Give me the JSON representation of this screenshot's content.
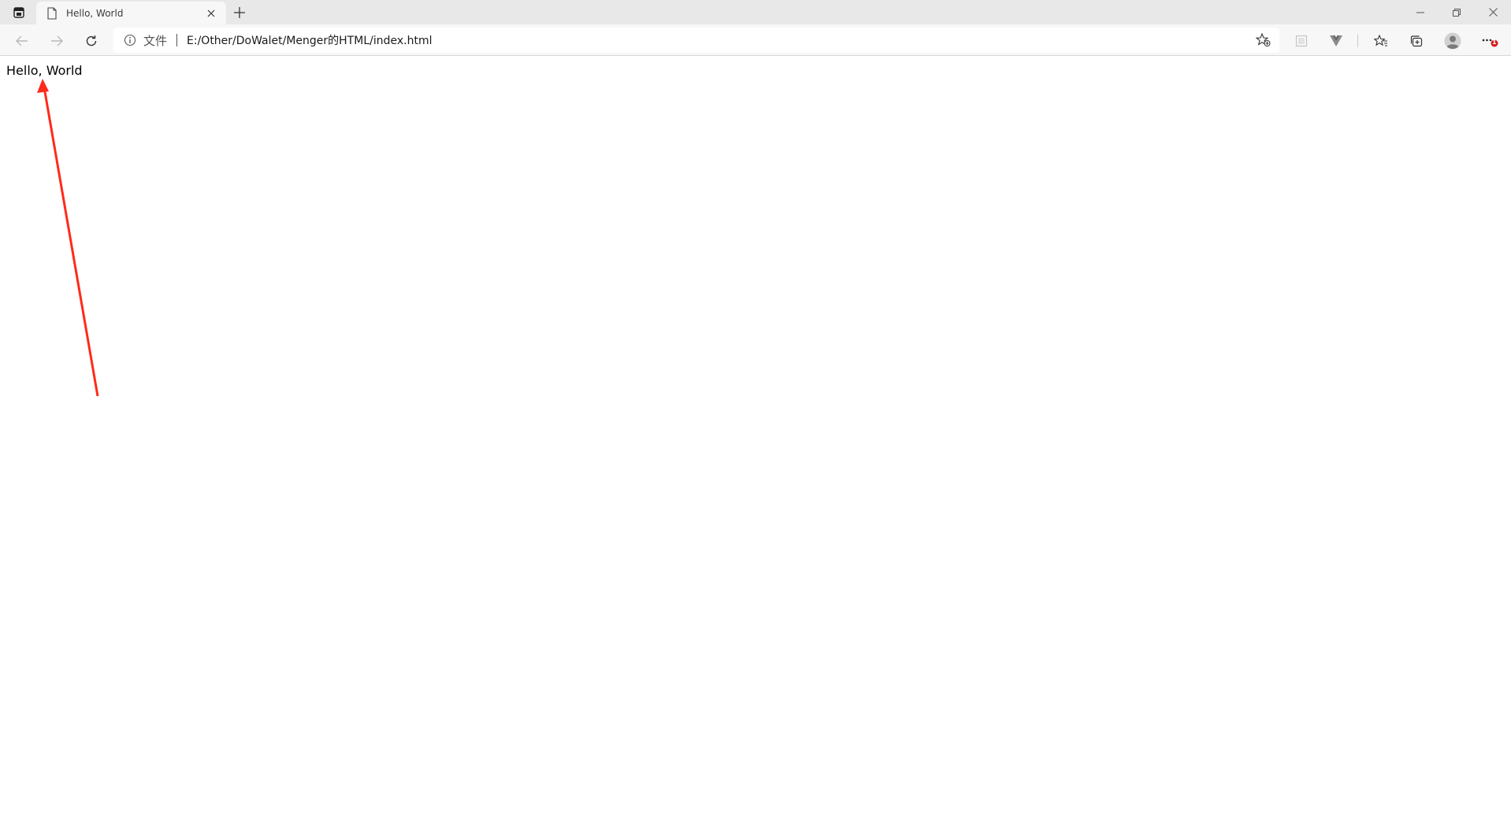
{
  "tab": {
    "title": "Hello, World"
  },
  "omnibox": {
    "scheme_label": "文件",
    "url": "E:/Other/DoWalet/Menger的HTML/index.html"
  },
  "page": {
    "text": "Hello, World"
  },
  "notification_badge": "1",
  "colors": {
    "annotation_arrow": "#ff2a1a",
    "badge": "#d81b1b"
  }
}
